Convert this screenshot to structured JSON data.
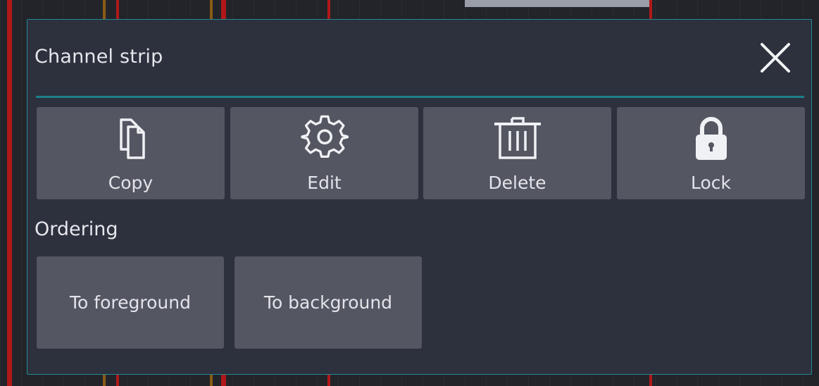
{
  "dialog": {
    "title": "Channel strip",
    "close_icon": "close-icon"
  },
  "actions": [
    {
      "label": "Copy",
      "icon": "copy-icon"
    },
    {
      "label": "Edit",
      "icon": "gear-icon"
    },
    {
      "label": "Delete",
      "icon": "trash-icon"
    },
    {
      "label": "Lock",
      "icon": "lock-icon"
    }
  ],
  "ordering": {
    "section_label": "Ordering",
    "buttons": [
      {
        "label": "To foreground"
      },
      {
        "label": "To background"
      }
    ]
  },
  "colors": {
    "dialog_bg": "#2d303d",
    "accent": "#1f8a96",
    "button_bg": "#545662",
    "text": "#e6e7ec"
  }
}
